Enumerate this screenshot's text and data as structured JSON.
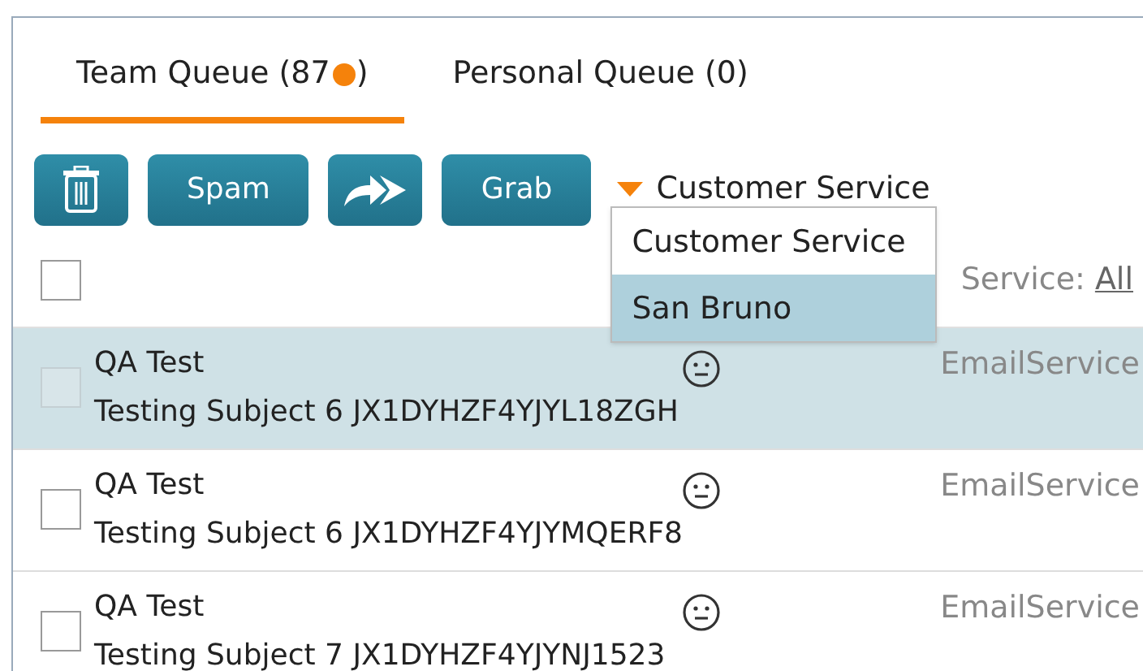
{
  "tabs": [
    {
      "label": "Team Queue (87",
      "color": "#f5820b",
      "suffix": ")",
      "selected": true
    },
    {
      "label": "Personal Queue (0)",
      "selected": false
    }
  ],
  "toolbar": {
    "buttons": [
      {
        "kind": "delete"
      },
      {
        "kind": "text",
        "label": "Spam"
      },
      {
        "kind": "forward"
      },
      {
        "kind": "text",
        "label": "Grab"
      }
    ],
    "dropdown": {
      "value": "Customer Service",
      "expanded": true,
      "options": [
        {
          "label": "Customer Service",
          "highlighted": false
        },
        {
          "label": "San Bruno",
          "highlighted": true
        }
      ]
    }
  },
  "header": {
    "select_all_checked": false,
    "service_label": "Service:",
    "service_link": "All"
  },
  "rows": [
    {
      "name": "QA Test",
      "subject": "Testing Subject 6 JX1DYHZF4YJYL18ZGH",
      "service": "EmailService",
      "selected": true,
      "checked": false
    },
    {
      "name": "QA Test",
      "subject": "Testing Subject 6 JX1DYHZF4YJYMQERF8",
      "service": "EmailService",
      "selected": false,
      "checked": false
    },
    {
      "name": "QA Test",
      "subject": "Testing Subject 7 JX1DYHZF4YJYNJ1523",
      "service": "EmailService",
      "selected": false,
      "checked": false
    }
  ]
}
